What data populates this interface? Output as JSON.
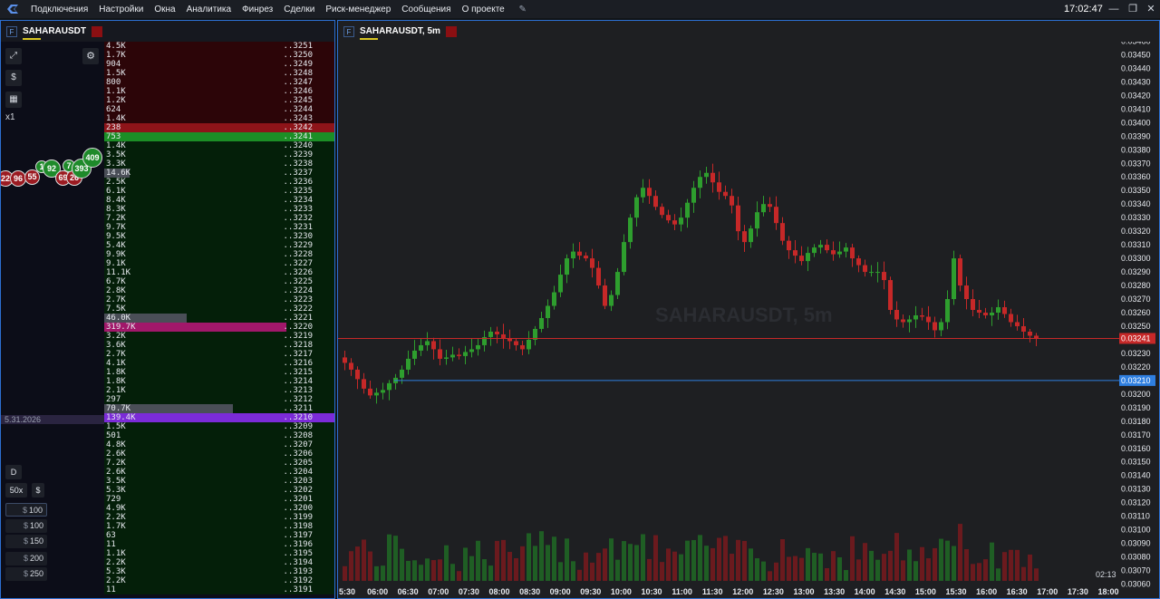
{
  "menu": {
    "items": [
      "Подключения",
      "Настройки",
      "Окна",
      "Аналитика",
      "Финрез",
      "Сделки",
      "Риск-менеджер",
      "Сообщения",
      "О проекте"
    ],
    "clock": "17:02:47"
  },
  "left": {
    "symbol": "SAHARAUSDT",
    "multiplier": "x1",
    "date": "5.31.2026",
    "mode_button": "D",
    "leverage": "50x",
    "currency_symbol": "$",
    "amounts": [
      "100",
      "100",
      "150",
      "200",
      "250"
    ],
    "bubbles": [
      {
        "label": "22",
        "side": "sell"
      },
      {
        "label": "96",
        "side": "sell"
      },
      {
        "label": "55",
        "side": "sell"
      },
      {
        "label": "1",
        "side": "buy"
      },
      {
        "label": "92",
        "side": "buy"
      },
      {
        "label": "69",
        "side": "sell"
      },
      {
        "label": "26",
        "side": "sell"
      },
      {
        "label": "7",
        "side": "buy"
      },
      {
        "label": "393",
        "side": "buy"
      },
      {
        "label": "409",
        "side": "buy"
      }
    ]
  },
  "orderbook": {
    "rows": [
      {
        "vol": "4.5K",
        "price": "..3251",
        "side": "ask"
      },
      {
        "vol": "1.7K",
        "price": "..3250",
        "side": "ask"
      },
      {
        "vol": "904",
        "price": "..3249",
        "side": "ask"
      },
      {
        "vol": "1.5K",
        "price": "..3248",
        "side": "ask"
      },
      {
        "vol": "800",
        "price": "..3247",
        "side": "ask"
      },
      {
        "vol": "1.1K",
        "price": "..3246",
        "side": "ask"
      },
      {
        "vol": "1.2K",
        "price": "..3245",
        "side": "ask"
      },
      {
        "vol": "624",
        "price": "..3244",
        "side": "ask"
      },
      {
        "vol": "1.4K",
        "price": "..3243",
        "side": "ask"
      },
      {
        "vol": "238",
        "price": "..3242",
        "side": "best-ask"
      },
      {
        "vol": "753",
        "price": "..3241",
        "side": "best-bid"
      },
      {
        "vol": "1.4K",
        "price": "..3240",
        "side": "bid"
      },
      {
        "vol": "3.5K",
        "price": "..3239",
        "side": "bid"
      },
      {
        "vol": "3.3K",
        "price": "..3238",
        "side": "bid"
      },
      {
        "vol": "14.6K",
        "price": "..3237",
        "side": "bid",
        "fill": 0.11
      },
      {
        "vol": "2.5K",
        "price": "..3236",
        "side": "bid"
      },
      {
        "vol": "6.1K",
        "price": "..3235",
        "side": "bid"
      },
      {
        "vol": "8.4K",
        "price": "..3234",
        "side": "bid"
      },
      {
        "vol": "8.3K",
        "price": "..3233",
        "side": "bid"
      },
      {
        "vol": "7.2K",
        "price": "..3232",
        "side": "bid"
      },
      {
        "vol": "9.7K",
        "price": "..3231",
        "side": "bid"
      },
      {
        "vol": "9.5K",
        "price": "..3230",
        "side": "bid"
      },
      {
        "vol": "5.4K",
        "price": "..3229",
        "side": "bid"
      },
      {
        "vol": "9.9K",
        "price": "..3228",
        "side": "bid"
      },
      {
        "vol": "9.1K",
        "price": "..3227",
        "side": "bid"
      },
      {
        "vol": "11.1K",
        "price": "..3226",
        "side": "bid"
      },
      {
        "vol": "6.7K",
        "price": "..3225",
        "side": "bid"
      },
      {
        "vol": "2.8K",
        "price": "..3224",
        "side": "bid"
      },
      {
        "vol": "2.7K",
        "price": "..3223",
        "side": "bid"
      },
      {
        "vol": "7.5K",
        "price": "..3222",
        "side": "bid"
      },
      {
        "vol": "46.0K",
        "price": "..3221",
        "side": "bid",
        "fill": 0.36
      },
      {
        "vol": "319.7K",
        "price": "..3220",
        "side": "bid",
        "fill": 0.79,
        "color": "pink"
      },
      {
        "vol": "3.2K",
        "price": "..3219",
        "side": "bid"
      },
      {
        "vol": "3.6K",
        "price": "..3218",
        "side": "bid"
      },
      {
        "vol": "2.7K",
        "price": "..3217",
        "side": "bid"
      },
      {
        "vol": "4.1K",
        "price": "..3216",
        "side": "bid"
      },
      {
        "vol": "1.8K",
        "price": "..3215",
        "side": "bid"
      },
      {
        "vol": "1.8K",
        "price": "..3214",
        "side": "bid"
      },
      {
        "vol": "2.1K",
        "price": "..3213",
        "side": "bid"
      },
      {
        "vol": "297",
        "price": "..3212",
        "side": "bid"
      },
      {
        "vol": "70.7K",
        "price": "..3211",
        "side": "bid",
        "fill": 0.56
      },
      {
        "vol": "139.4K",
        "price": "..3210",
        "side": "bid",
        "fill": 1.0,
        "color": "purple"
      },
      {
        "vol": "1.5K",
        "price": "..3209",
        "side": "bid"
      },
      {
        "vol": "501",
        "price": "..3208",
        "side": "bid"
      },
      {
        "vol": "4.8K",
        "price": "..3207",
        "side": "bid"
      },
      {
        "vol": "2.6K",
        "price": "..3206",
        "side": "bid"
      },
      {
        "vol": "7.2K",
        "price": "..3205",
        "side": "bid"
      },
      {
        "vol": "2.6K",
        "price": "..3204",
        "side": "bid"
      },
      {
        "vol": "3.5K",
        "price": "..3203",
        "side": "bid"
      },
      {
        "vol": "5.3K",
        "price": "..3202",
        "side": "bid"
      },
      {
        "vol": "729",
        "price": "..3201",
        "side": "bid"
      },
      {
        "vol": "4.9K",
        "price": "..3200",
        "side": "bid"
      },
      {
        "vol": "2.2K",
        "price": "..3199",
        "side": "bid"
      },
      {
        "vol": "1.7K",
        "price": "..3198",
        "side": "bid"
      },
      {
        "vol": "63",
        "price": "..3197",
        "side": "bid"
      },
      {
        "vol": "11",
        "price": "..3196",
        "side": "bid"
      },
      {
        "vol": "1.1K",
        "price": "..3195",
        "side": "bid"
      },
      {
        "vol": "2.2K",
        "price": "..3194",
        "side": "bid"
      },
      {
        "vol": "5.3K",
        "price": "..3193",
        "side": "bid"
      },
      {
        "vol": "2.2K",
        "price": "..3192",
        "side": "bid"
      },
      {
        "vol": "11",
        "price": "..3191",
        "side": "bid"
      }
    ]
  },
  "chart": {
    "symbol": "SAHARAUSDT, 5m",
    "watermark": "SAHARAUSDT, 5m",
    "timer": "02:13",
    "colors": {
      "up": "#2e9e2e",
      "down": "#c62828",
      "last_price": "#c62828",
      "order_line": "#2f7fe0"
    }
  },
  "chart_data": {
    "type": "candlestick",
    "interval": "5m",
    "price_axis": {
      "ticks": [
        "0.03460",
        "0.03450",
        "0.03440",
        "0.03430",
        "0.03420",
        "0.03410",
        "0.03400",
        "0.03390",
        "0.03380",
        "0.03370",
        "0.03360",
        "0.03350",
        "0.03340",
        "0.03330",
        "0.03320",
        "0.03310",
        "0.03300",
        "0.03290",
        "0.03280",
        "0.03270",
        "0.03260",
        "0.03250",
        "0.03240",
        "0.03230",
        "0.03220",
        "0.03210",
        "0.03200",
        "0.03190",
        "0.03180",
        "0.03170",
        "0.03160",
        "0.03150",
        "0.03140",
        "0.03130",
        "0.03120",
        "0.03110",
        "0.03100",
        "0.03090",
        "0.03080",
        "0.03070",
        "0.03060"
      ],
      "range": [
        0.03055,
        0.03465
      ]
    },
    "time_axis": {
      "ticks": [
        "5:30",
        "06:00",
        "06:30",
        "07:00",
        "07:30",
        "08:00",
        "08:30",
        "09:00",
        "09:30",
        "10:00",
        "10:30",
        "11:00",
        "11:30",
        "12:00",
        "12:30",
        "13:00",
        "13:30",
        "14:00",
        "14:30",
        "15:00",
        "15:30",
        "16:00",
        "16:30",
        "17:00",
        "17:30",
        "18:00"
      ]
    },
    "last_price": {
      "value": 0.03241,
      "label": "0.03241"
    },
    "order_line": {
      "value": 0.0321,
      "label": "0.03210"
    },
    "series": [
      {
        "name": "close",
        "values": [
          0.03223,
          0.03218,
          0.03211,
          0.03204,
          0.03199,
          0.03201,
          0.03203,
          0.03208,
          0.03212,
          0.03218,
          0.03226,
          0.03232,
          0.03236,
          0.03239,
          0.03233,
          0.03226,
          0.03227,
          0.03229,
          0.03228,
          0.03231,
          0.03233,
          0.03236,
          0.03242,
          0.03246,
          0.03244,
          0.03241,
          0.03239,
          0.03236,
          0.03233,
          0.0324,
          0.03248,
          0.03256,
          0.03265,
          0.03275,
          0.03288,
          0.033,
          0.03305,
          0.03302,
          0.033,
          0.03293,
          0.0328,
          0.03265,
          0.03273,
          0.0329,
          0.03312,
          0.0333,
          0.03345,
          0.03352,
          0.03346,
          0.03338,
          0.03332,
          0.03328,
          0.03325,
          0.0333,
          0.03341,
          0.03352,
          0.0336,
          0.03363,
          0.03356,
          0.03349,
          0.03346,
          0.03339,
          0.0332,
          0.03312,
          0.03322,
          0.03334,
          0.0334,
          0.03338,
          0.03326,
          0.03313,
          0.03306,
          0.03302,
          0.03298,
          0.03304,
          0.03308,
          0.0331,
          0.03306,
          0.03303,
          0.03305,
          0.03308,
          0.033,
          0.03295,
          0.0329,
          0.0329,
          0.0329,
          0.03284,
          0.03262,
          0.03255,
          0.03253,
          0.03255,
          0.03258,
          0.03257,
          0.03253,
          0.03247,
          0.03253,
          0.0327,
          0.033,
          0.0328,
          0.0327,
          0.03262,
          0.0326,
          0.03258,
          0.0326,
          0.03264,
          0.03259,
          0.03253,
          0.0325,
          0.03246,
          0.03243,
          0.03241
        ]
      },
      {
        "name": "volume"
      }
    ]
  }
}
